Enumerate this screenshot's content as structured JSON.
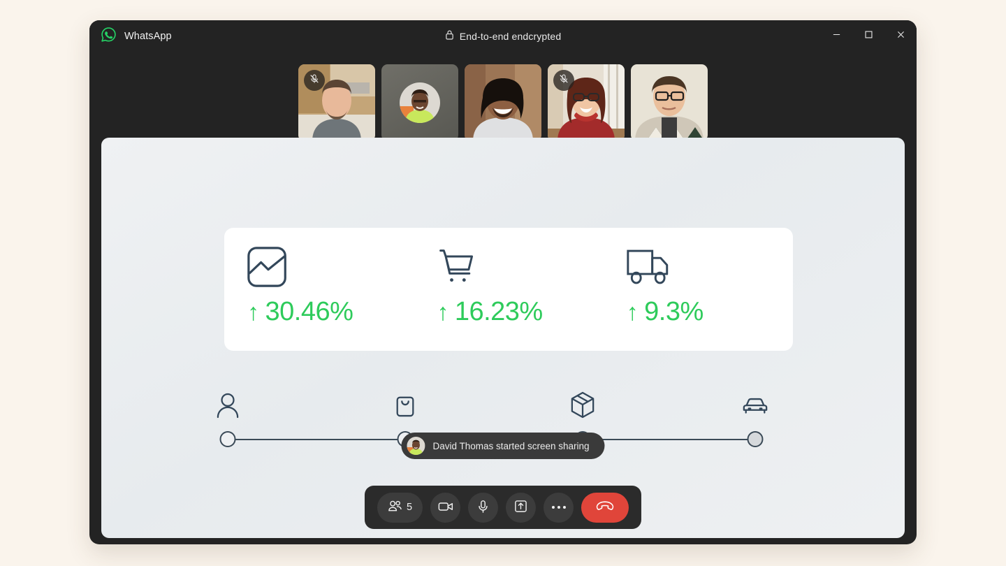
{
  "window": {
    "brand": "WhatsApp",
    "brand_icon": "whatsapp-logo-icon",
    "encryption_label": "End-to-end endcrypted",
    "lock_icon": "lock-icon",
    "controls": {
      "minimize": "minimize-icon",
      "maximize": "maximize-icon",
      "close": "close-icon"
    }
  },
  "participants": [
    {
      "name": "participant-1",
      "muted": true,
      "type": "video",
      "bg": "#b99a6e"
    },
    {
      "name": "participant-2",
      "muted": false,
      "type": "avatar",
      "bg": "#6b6a63"
    },
    {
      "name": "participant-3",
      "muted": false,
      "type": "video",
      "bg": "#7a5c48"
    },
    {
      "name": "participant-4",
      "muted": true,
      "type": "video",
      "bg": "#c9b49c"
    },
    {
      "name": "participant-5",
      "muted": false,
      "type": "video",
      "bg": "#d8d2c4"
    }
  ],
  "shared_screen": {
    "metrics": [
      {
        "icon": "chart-analytics-icon",
        "arrow": "↑",
        "value": "30.46%"
      },
      {
        "icon": "shopping-cart-icon",
        "arrow": "↑",
        "value": "16.23%"
      },
      {
        "icon": "delivery-truck-icon",
        "arrow": "↑",
        "value": "9.3%"
      }
    ],
    "stepper": {
      "steps": [
        {
          "icon": "person-icon",
          "position": 0,
          "filled": false
        },
        {
          "icon": "shopping-bag-icon",
          "position": 33.5,
          "filled": false
        },
        {
          "icon": "package-box-icon",
          "position": 67,
          "filled": false
        },
        {
          "icon": "car-delivery-icon",
          "position": 100,
          "filled": true
        }
      ]
    }
  },
  "toast": {
    "avatar": "david-thomas-avatar",
    "message": "David Thomas started screen sharing"
  },
  "controlbar": {
    "participants_button": {
      "icon": "people-group-icon",
      "count": "5"
    },
    "camera_button": {
      "icon": "video-camera-icon"
    },
    "mic_button": {
      "icon": "microphone-icon"
    },
    "share_button": {
      "icon": "share-screen-icon"
    },
    "more_button": {
      "icon": "more-options-icon"
    },
    "end_call_button": {
      "icon": "end-call-icon"
    }
  },
  "colors": {
    "page_background": "#faf4ec",
    "window_chrome": "#232323",
    "accent_green": "#2ecb5b",
    "brand_green": "#25d366",
    "end_call_red": "#e0453a",
    "icon_slate": "#3b4a57"
  }
}
